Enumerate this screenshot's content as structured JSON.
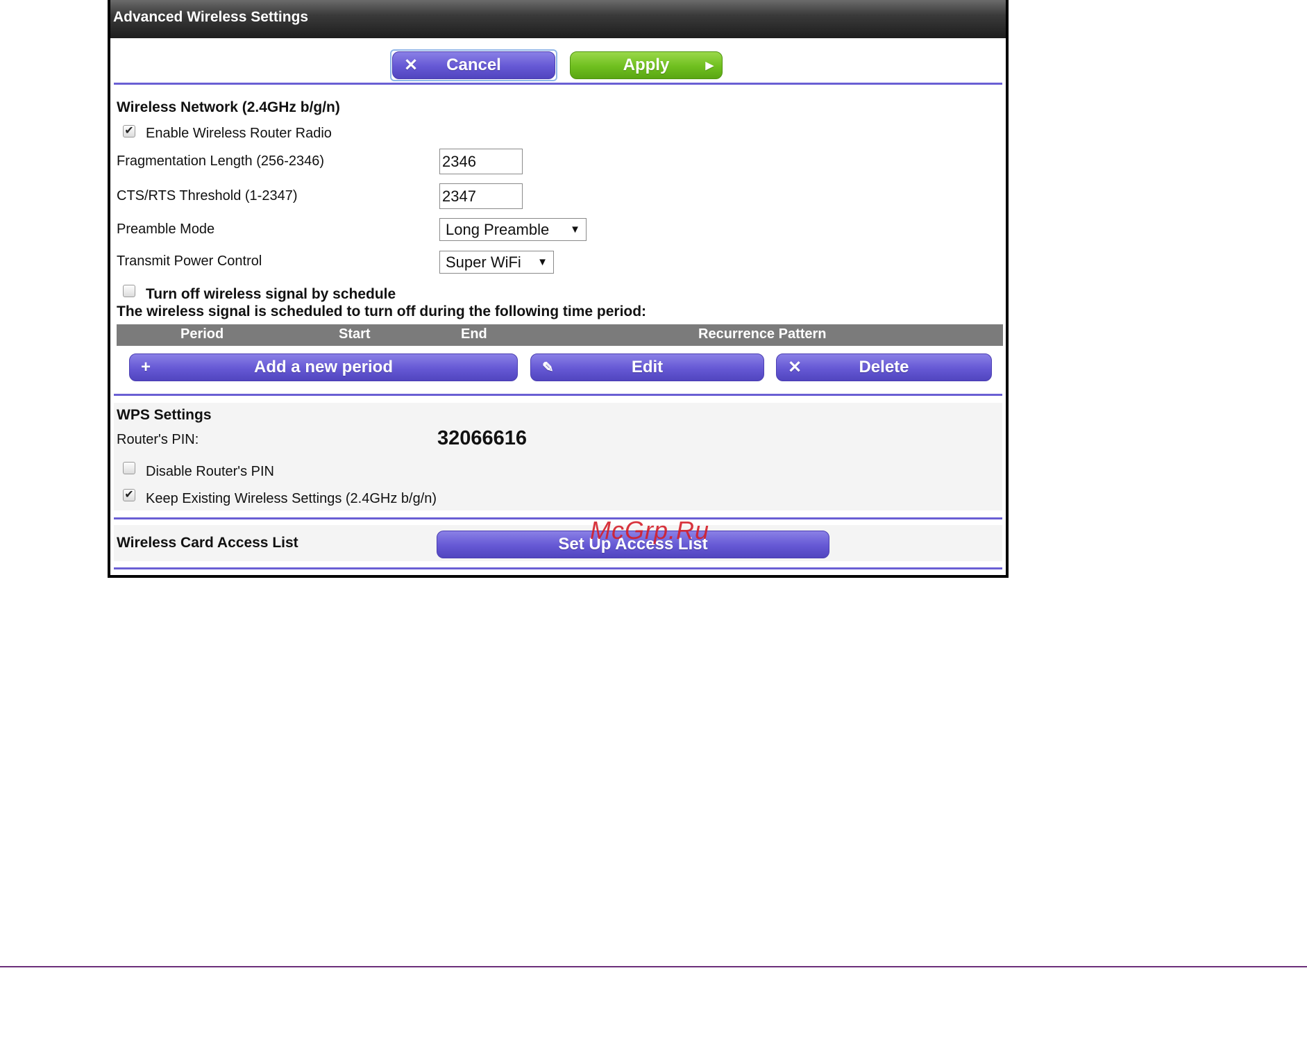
{
  "panel": {
    "title": "Advanced Wireless Settings"
  },
  "toolbar": {
    "cancel_label": "Cancel",
    "apply_label": "Apply"
  },
  "wireless": {
    "section_title": "Wireless Network (2.4GHz b/g/n)",
    "enable_radio_label": "Enable Wireless Router Radio",
    "enable_radio_checked": true,
    "frag_label": "Fragmentation Length (256-2346)",
    "frag_value": "2346",
    "cts_label": "CTS/RTS Threshold (1-2347)",
    "cts_value": "2347",
    "preamble_label": "Preamble Mode",
    "preamble_value": "Long Preamble",
    "power_label": "Transmit Power Control",
    "power_value": "Super WiFi",
    "schedule_label": "Turn off wireless signal by schedule",
    "schedule_checked": false,
    "schedule_note": "The wireless signal is scheduled to turn off during the following time period:"
  },
  "schedule_table": {
    "columns": [
      "Period",
      "Start",
      "End",
      "Recurrence Pattern"
    ],
    "rows": []
  },
  "schedule_actions": {
    "add_label": "Add a new period",
    "edit_label": "Edit",
    "delete_label": "Delete"
  },
  "wps": {
    "section_title": "WPS Settings",
    "pin_label": "Router's PIN:",
    "pin_value": "32066616",
    "disable_pin_label": "Disable Router's PIN",
    "disable_pin_checked": false,
    "keep_settings_label": "Keep Existing Wireless Settings (2.4GHz b/g/n)",
    "keep_settings_checked": true
  },
  "access_list": {
    "label": "Wireless Card Access List",
    "button_label": "Set Up Access List"
  },
  "watermark": "McGrp.Ru",
  "icons": {
    "cancel": "close-icon",
    "apply": "arrow-right-icon",
    "add": "plus-icon",
    "edit": "pencil-icon",
    "delete": "close-icon"
  },
  "colors": {
    "accent_purple": "#6558d4",
    "apply_green": "#6fbf1f",
    "titlebar": "#2a2a2a",
    "table_header": "#7b7b7b"
  }
}
